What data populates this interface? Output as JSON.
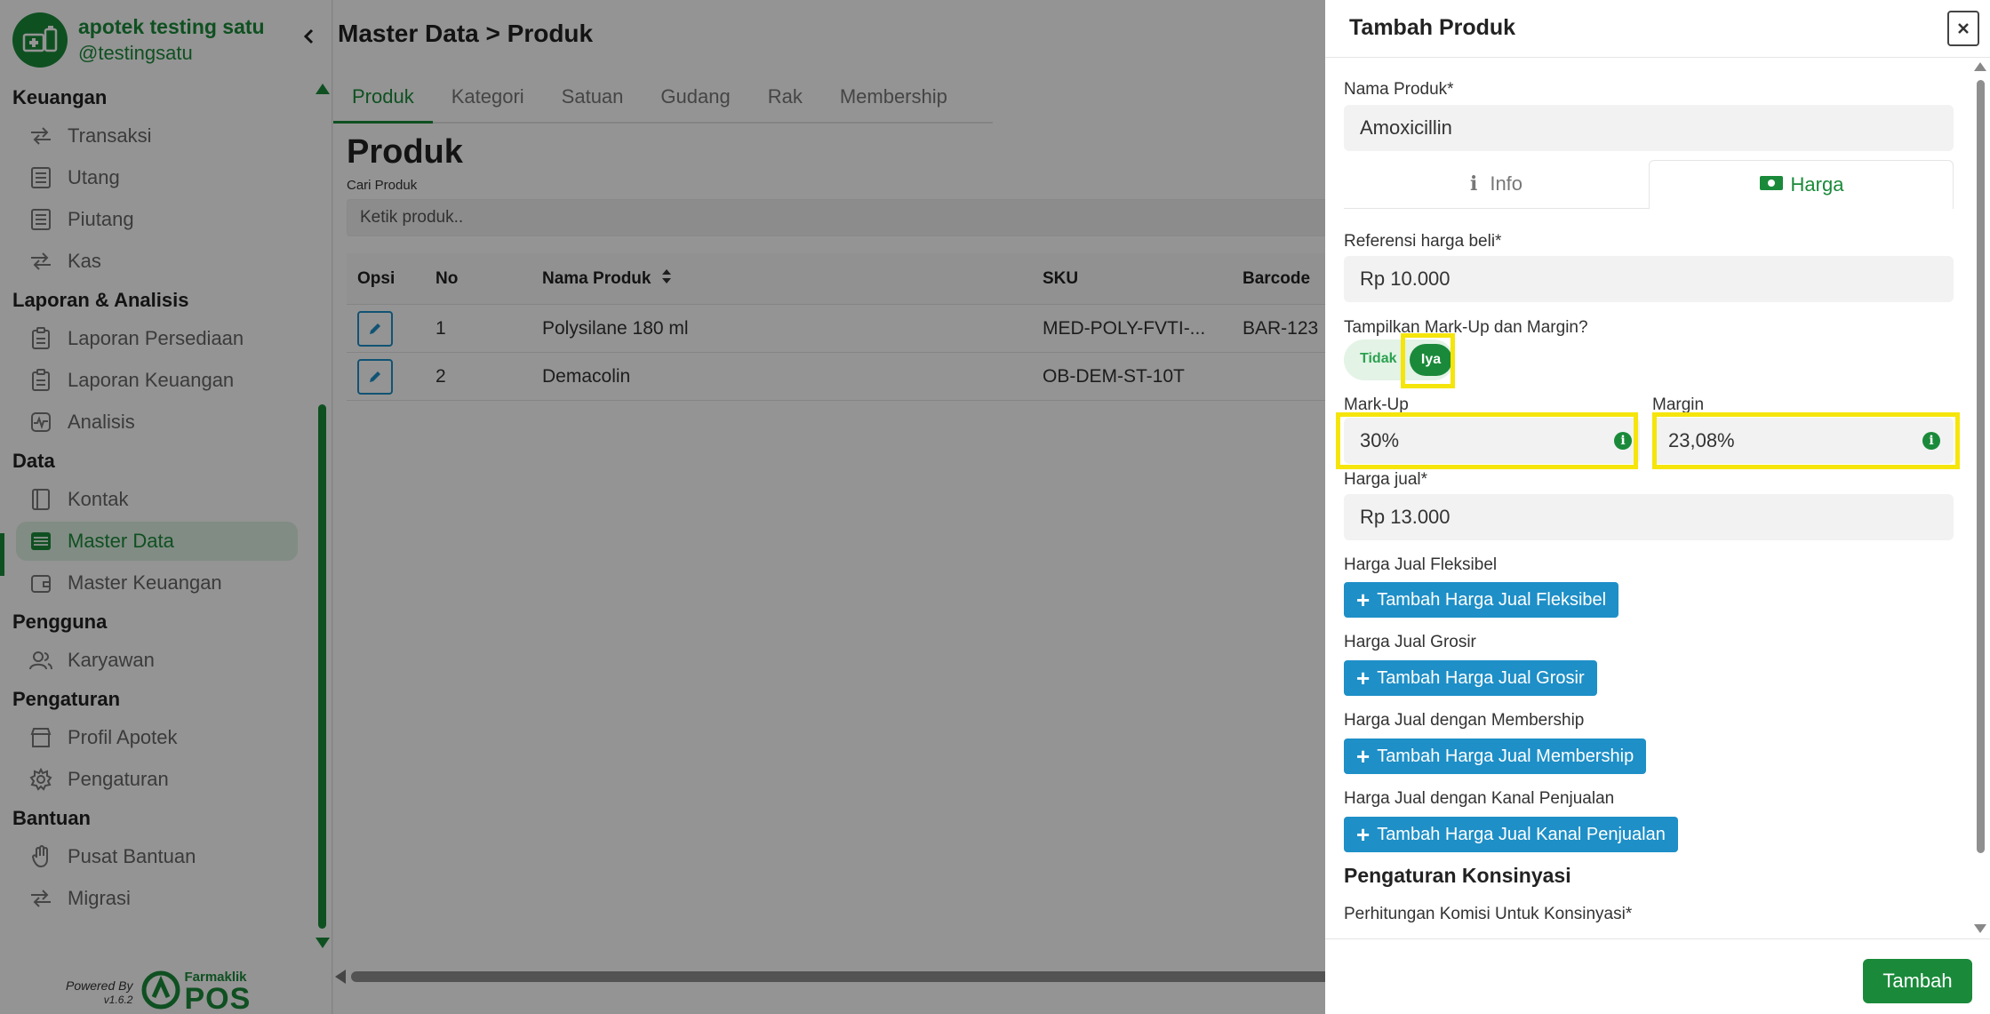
{
  "app": {
    "name": "apotek testing satu",
    "handle": "@testingsatu"
  },
  "sidebar": {
    "sections": [
      {
        "title": "Keuangan",
        "items": [
          {
            "label": "Transaksi",
            "icon": "transfer-icon"
          },
          {
            "label": "Utang",
            "icon": "ledger-icon"
          },
          {
            "label": "Piutang",
            "icon": "ledger-icon"
          },
          {
            "label": "Kas",
            "icon": "transfer-icon"
          }
        ]
      },
      {
        "title": "Laporan & Analisis",
        "items": [
          {
            "label": "Laporan Persediaan",
            "icon": "clipboard-icon"
          },
          {
            "label": "Laporan Keuangan",
            "icon": "clipboard-icon"
          },
          {
            "label": "Analisis",
            "icon": "analytics-icon"
          }
        ]
      },
      {
        "title": "Data",
        "items": [
          {
            "label": "Kontak",
            "icon": "contact-book-icon"
          },
          {
            "label": "Master Data",
            "icon": "database-icon"
          },
          {
            "label": "Master Keuangan",
            "icon": "wallet-icon"
          }
        ]
      },
      {
        "title": "Pengguna",
        "items": [
          {
            "label": "Karyawan",
            "icon": "users-icon"
          }
        ]
      },
      {
        "title": "Pengaturan",
        "items": [
          {
            "label": "Profil Apotek",
            "icon": "store-icon"
          },
          {
            "label": "Pengaturan",
            "icon": "gear-icon"
          }
        ]
      },
      {
        "title": "Bantuan",
        "items": [
          {
            "label": "Pusat Bantuan",
            "icon": "hand-icon"
          },
          {
            "label": "Migrasi",
            "icon": "transfer-icon"
          }
        ]
      }
    ],
    "active_item": "Master Data",
    "powered_by": "Powered By",
    "version": "v1.6.2",
    "brand_small": "Farmaklik",
    "brand_big": "POS"
  },
  "main": {
    "breadcrumb": "Master Data > Produk",
    "tabs": [
      "Produk",
      "Kategori",
      "Satuan",
      "Gudang",
      "Rak",
      "Membership"
    ],
    "active_tab": "Produk",
    "page_title": "Produk",
    "search": {
      "label": "Cari Produk",
      "placeholder": "Ketik produk.."
    },
    "table": {
      "headers": {
        "opsi": "Opsi",
        "no": "No",
        "nama": "Nama Produk",
        "sku": "SKU",
        "barcode": "Barcode"
      },
      "rows": [
        {
          "no": "1",
          "nama": "Polysilane 180 ml",
          "sku": "MED-POLY-FVTI-...",
          "barcode": "BAR-123"
        },
        {
          "no": "2",
          "nama": "Demacolin",
          "sku": "OB-DEM-ST-10T",
          "barcode": ""
        }
      ]
    }
  },
  "drawer": {
    "title": "Tambah Produk",
    "close": "×",
    "nama_label": "Nama Produk*",
    "nama_value": "Amoxicillin",
    "tab_info": "Info",
    "tab_harga": "Harga",
    "ref_label": "Referensi harga beli*",
    "ref_value": "Rp 10.000",
    "show_label": "Tampilkan Mark-Up dan Margin?",
    "toggle_off": "Tidak",
    "toggle_on": "Iya",
    "markup_label": "Mark-Up",
    "markup_value": "30%",
    "margin_label": "Margin",
    "margin_value": "23,08%",
    "jual_label": "Harga jual*",
    "jual_value": "Rp 13.000",
    "fleksibel_label": "Harga Jual Fleksibel",
    "fleksibel_btn": "Tambah Harga Jual Fleksibel",
    "grosir_label": "Harga Jual Grosir",
    "grosir_btn": "Tambah Harga Jual Grosir",
    "membership_label": "Harga Jual dengan Membership",
    "membership_btn": "Tambah Harga Jual Membership",
    "kanal_label": "Harga Jual dengan Kanal Penjualan",
    "kanal_btn": "Tambah Harga Jual Kanal Penjualan",
    "konsinyasi_title": "Pengaturan Konsinyasi",
    "komisi_label": "Perhitungan Komisi Untuk Konsinyasi*",
    "submit": "Tambah"
  },
  "colors": {
    "brand_green": "#1a8a3a",
    "action_blue": "#1e8fc7",
    "highlight_yellow": "#f5e50a"
  }
}
